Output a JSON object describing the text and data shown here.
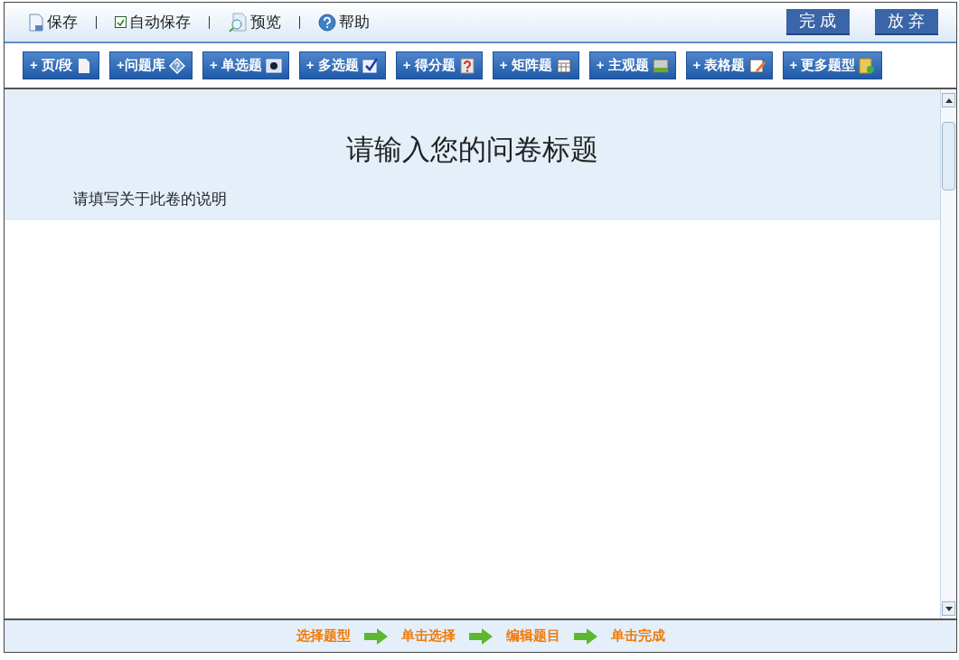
{
  "top_bar": {
    "links": [
      {
        "kind": "button",
        "label": "保存"
      },
      {
        "kind": "checkbox",
        "label": "自动保存",
        "checked": true
      },
      {
        "kind": "button",
        "label": "预览"
      },
      {
        "kind": "button",
        "label": "帮助"
      }
    ],
    "actions": [
      "完 成",
      "放 弃"
    ]
  },
  "toolbar": [
    "+ 页/段",
    "+问题库",
    "+ 单选题",
    "+ 多选题",
    "+ 得分题",
    "+ 矩阵题",
    "+ 主观题",
    "+ 表格题",
    "+ 更多题型"
  ],
  "survey": {
    "title": "请输入您的问卷标题",
    "description": "请填写关于此卷的说明"
  },
  "steps": [
    "选择题型",
    "单击选择",
    "编辑题目",
    "单击完成"
  ]
}
